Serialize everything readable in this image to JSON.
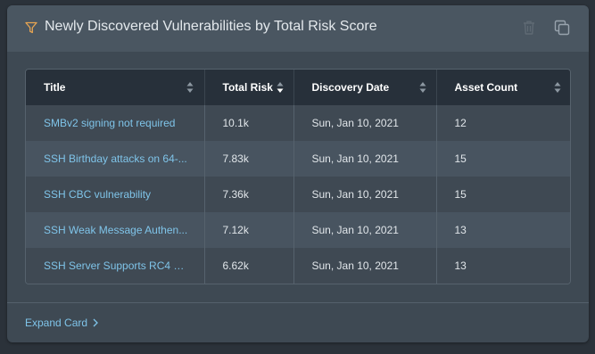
{
  "card": {
    "title": "Newly Discovered Vulnerabilities by Total Risk Score",
    "expand_label": "Expand Card",
    "colors": {
      "accent": "#e8a552",
      "link": "#7fc4e9"
    },
    "icons": {
      "filter": "filter-icon",
      "delete": "trash-icon",
      "duplicate": "copy-icon",
      "expand": "chevron-right-icon"
    }
  },
  "table": {
    "columns": [
      {
        "label": "Title",
        "sort": "none"
      },
      {
        "label": "Total Risk",
        "sort": "descending"
      },
      {
        "label": "Discovery Date",
        "sort": "none"
      },
      {
        "label": "Asset Count",
        "sort": "none"
      }
    ],
    "rows": [
      {
        "title": "SMBv2 signing not required",
        "total_risk": "10.1k",
        "discovery_date": "Sun, Jan 10, 2021",
        "asset_count": "12"
      },
      {
        "title": "SSH Birthday attacks on 64-...",
        "total_risk": "7.83k",
        "discovery_date": "Sun, Jan 10, 2021",
        "asset_count": "15"
      },
      {
        "title": "SSH CBC vulnerability",
        "total_risk": "7.36k",
        "discovery_date": "Sun, Jan 10, 2021",
        "asset_count": "15"
      },
      {
        "title": "SSH Weak Message Authen...",
        "total_risk": "7.12k",
        "discovery_date": "Sun, Jan 10, 2021",
        "asset_count": "13"
      },
      {
        "title": "SSH Server Supports RC4 Ci...",
        "total_risk": "6.62k",
        "discovery_date": "Sun, Jan 10, 2021",
        "asset_count": "13"
      }
    ]
  }
}
